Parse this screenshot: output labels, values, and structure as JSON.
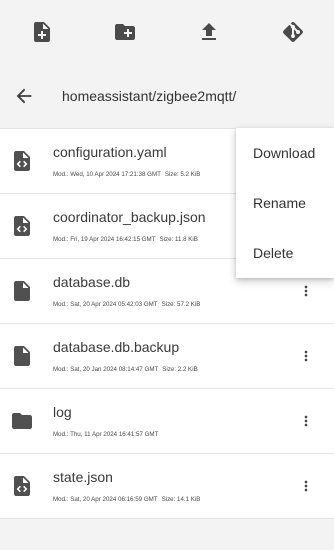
{
  "toolbar": {
    "icons": [
      "new-file-icon",
      "new-folder-icon",
      "upload-icon",
      "git-icon"
    ]
  },
  "path": {
    "text": "homeassistant/zigbee2mqtt/"
  },
  "files": [
    {
      "name": "configuration.yaml",
      "icon": "code-file-icon",
      "mod": "Mod.: Wed, 10 Apr 2024 17:21:38 GMT",
      "size": "Size: 5.2 KiB",
      "menu_button": false
    },
    {
      "name": "coordinator_backup.json",
      "icon": "code-file-icon",
      "mod": "Mod.: Fri, 19 Apr 2024 16:42:15 GMT",
      "size": "Size: 11.8 KiB",
      "menu_button": false
    },
    {
      "name": "database.db",
      "icon": "file-icon",
      "mod": "Mod.: Sat, 20 Apr 2024 05:42:03 GMT",
      "size": "Size: 57.2 KiB",
      "menu_button": true
    },
    {
      "name": "database.db.backup",
      "icon": "file-icon",
      "mod": "Mod.: Sat, 20 Jan 2024 08:14:47 GMT",
      "size": "Size: 2.2 KiB",
      "menu_button": true
    },
    {
      "name": "log",
      "icon": "folder-icon",
      "mod": "Mod.: Thu, 11 Apr 2024 16:41:57 GMT",
      "size": "",
      "menu_button": true
    },
    {
      "name": "state.json",
      "icon": "code-file-icon",
      "mod": "Mod.: Sat, 20 Apr 2024 06:16:59 GMT",
      "size": "Size: 14.1 KiB",
      "menu_button": true
    }
  ],
  "context_menu": {
    "items": [
      "Download",
      "Rename",
      "Delete"
    ]
  }
}
